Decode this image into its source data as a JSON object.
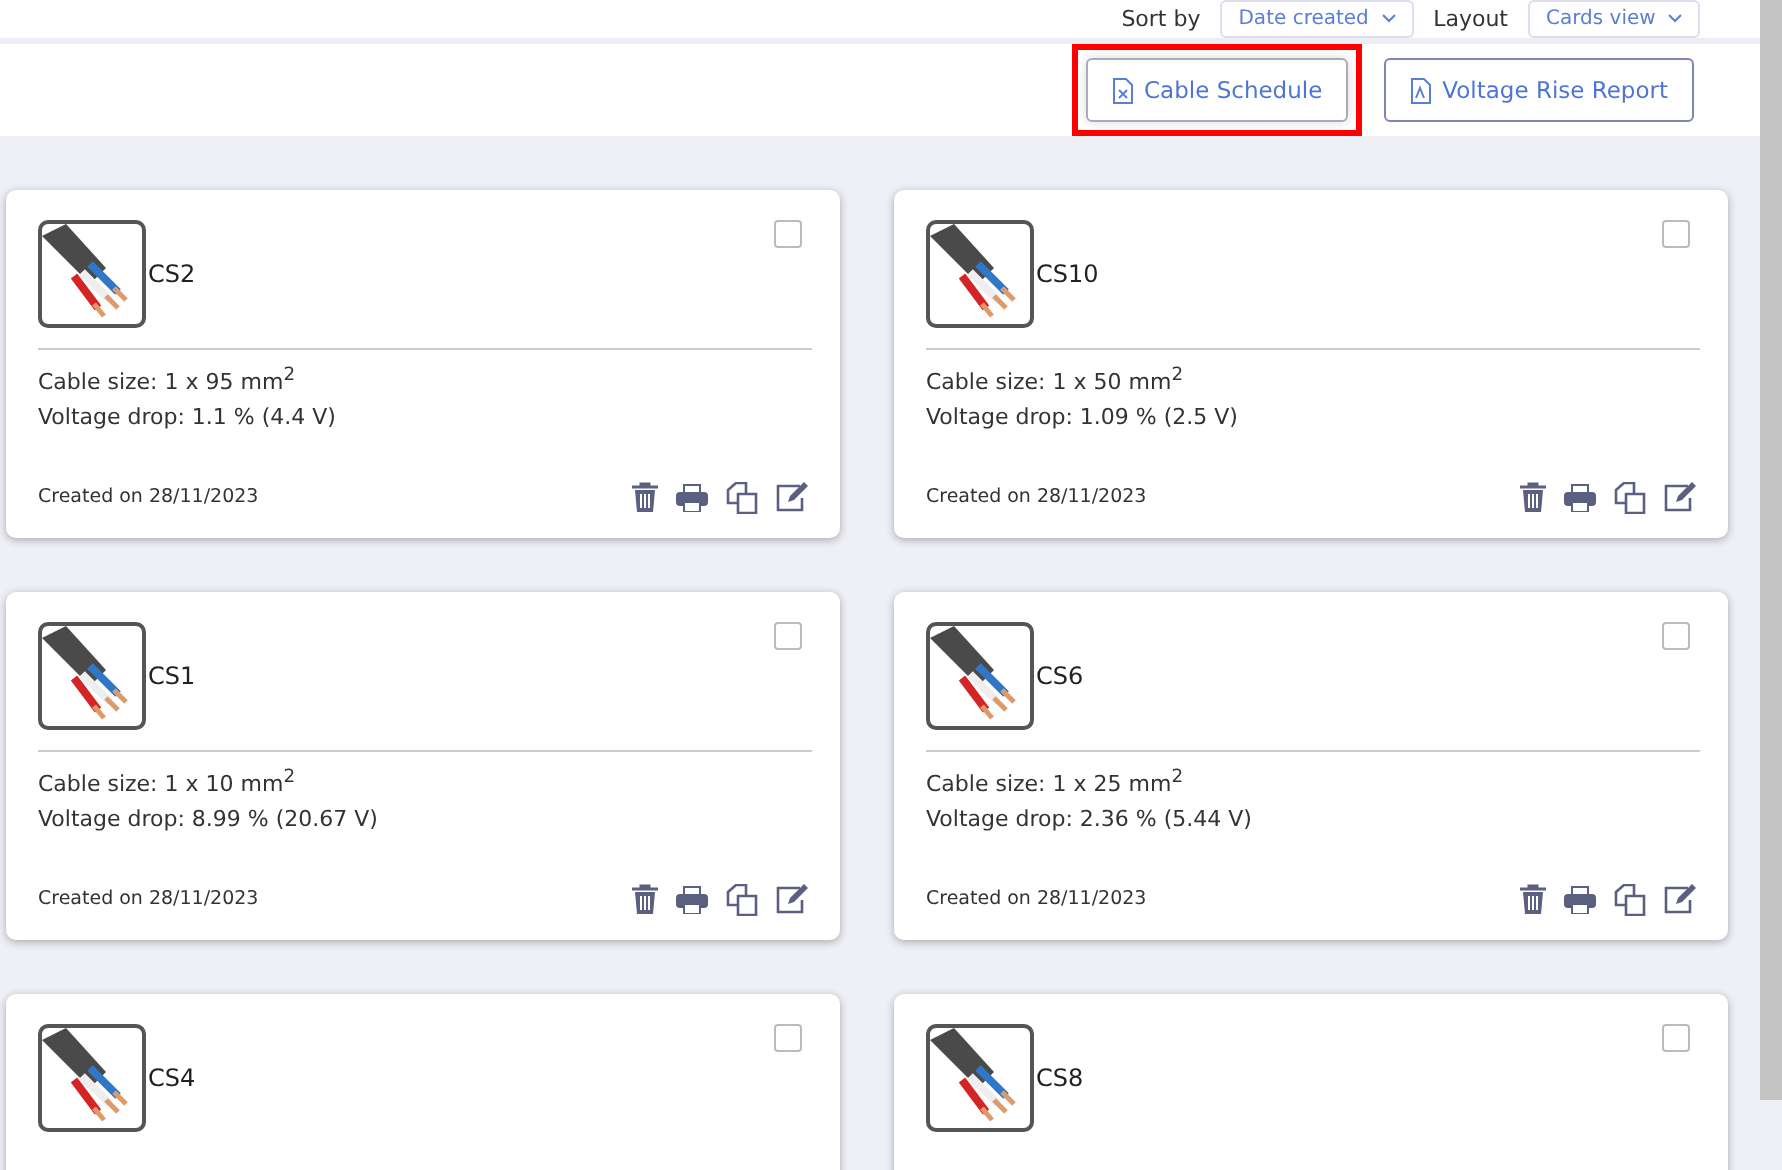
{
  "toolbar": {
    "sort_label": "Sort by",
    "sort_value": "Date created",
    "layout_label": "Layout",
    "layout_value": "Cards view"
  },
  "actions": [
    {
      "label": "Cable Schedule",
      "kind": "excel",
      "highlighted": true
    },
    {
      "label": "Voltage Rise Report",
      "kind": "pdf",
      "highlighted": false
    }
  ],
  "cards": [
    {
      "name": "CS2",
      "checked": false,
      "size": "Cable size: 1 x 95 mm$^{2}$",
      "drop": "Voltage drop: 1.1 % (4.4 V)",
      "created": "Created on 28/11/2023"
    },
    {
      "name": "CS10",
      "checked": false,
      "size": "Cable size: 1 x 50 mm$^{2}$",
      "drop": "Voltage drop: 1.09 % (2.5 V)",
      "created": "Created on 28/11/2023"
    },
    {
      "name": "CS1",
      "checked": false,
      "size": "Cable size: 1 x 10 mm$^{2}$",
      "drop": "Voltage drop: 8.99 % (20.67 V)",
      "created": "Created on 28/11/2023"
    },
    {
      "name": "CS6",
      "checked": false,
      "size": "Cable size: 1 x 25 mm$^{2}$",
      "drop": "Voltage drop: 2.36 % (5.44 V)",
      "created": "Created on 28/11/2023"
    },
    {
      "name": "CS4",
      "checked": false
    },
    {
      "name": "CS8",
      "checked": false
    }
  ]
}
